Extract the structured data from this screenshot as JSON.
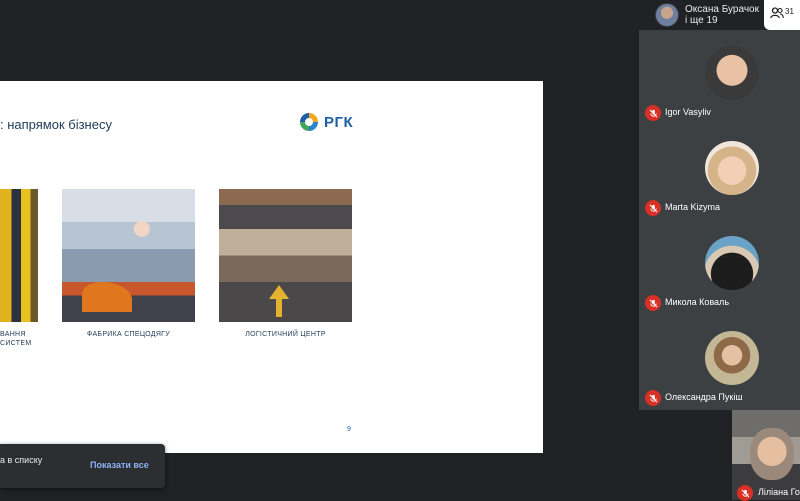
{
  "presenter": {
    "name_line1": "Оксана Бурачок",
    "name_line2": "і ще 19"
  },
  "people_button": {
    "count": "31",
    "icon": "people-icon"
  },
  "slide": {
    "title": ": напрямок бізнесу",
    "logo_text": "РГК",
    "captions": {
      "first_line1": "ВАННЯ",
      "first_line2": "СИСТЕМ",
      "second": "ФАБРИКА СПЕЦОДЯГУ",
      "third": "ЛОГІСТИЧНИЙ ЦЕНТР"
    },
    "page_number": "9"
  },
  "participants": [
    {
      "name": "Igor Vasyliv",
      "muted": true
    },
    {
      "name": "Marta Kizyma",
      "muted": true
    },
    {
      "name": "Микола Коваль",
      "muted": true
    },
    {
      "name": "Олександра Пукіш",
      "muted": true
    },
    {
      "name": "Ліліана Го",
      "muted": true
    }
  ],
  "toast": {
    "text": "а в списку",
    "button": "Показати все"
  },
  "colors": {
    "background": "#202124",
    "tile": "#3c4043",
    "muted_red": "#d93025",
    "link_blue": "#8ab4f8"
  }
}
